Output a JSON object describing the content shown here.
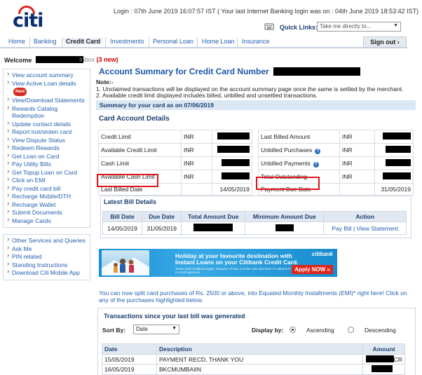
{
  "header": {
    "logo_text": "citi",
    "login_info": "Login : 07th June 2019 16:07:57 IST ( Your last Internet Banking login was on : 04th June 2019 18:53:42 IST)",
    "quick_links_label": "Quick Links:",
    "quick_links_placeholder": "Take me directly to...",
    "sign_out": "Sign out"
  },
  "nav": [
    "Home",
    "Banking",
    "Credit Card",
    "Investments",
    "Personal Loan",
    "Home Loan",
    "Insurance"
  ],
  "welcome": {
    "label": "Welcome",
    "inbox": "Inbox",
    "inbox_new": "(3 new)"
  },
  "sidebar": {
    "group1": [
      "View account summary",
      "View Active Loan details",
      "View/Download Statements",
      "Rewards Catalog Redemption",
      "Update contact details",
      "Report lost/stolen card",
      "View Dispute Status",
      "Redeem Rewards",
      "Get Loan on Card",
      "Pay Utility Bills",
      "Get Topup Loan on Card",
      "Click an EMI",
      "Pay credit card bill",
      "Recharge Mobile/DTH",
      "Recharge Wallet",
      "Submit Documents",
      "Manage Cards"
    ],
    "new_badge": "New",
    "group2": [
      "Other Services and Queries",
      "Ask Me",
      "PIN related",
      "Standing Instructions",
      "Download Citi Mobile App"
    ]
  },
  "main": {
    "title": "Account Summary for Credit Card Number",
    "note_heading": "Note:-",
    "note_1": "1. Unclaimed transactions will be displayed on the account summary page once the same is settled by the merchant.",
    "note_2": "2. Available credit limit displayed includes billed, unbilled and unsettled transactions.",
    "summary_band": "Summary for your card as on 07/06/2019",
    "card_title": "Card Account Details",
    "currency": "INR",
    "left_rows": [
      "Credit Limit",
      "Available Credit Limit",
      "Cash Limit",
      "Available Cash Limit",
      "Last Billed Date"
    ],
    "last_billed_date": "14/05/2019",
    "right_rows": [
      "Last Billed Amount",
      "Unbilled Purchases",
      "Unbilled Payments",
      "Total Outstanding",
      "Payment Due Date"
    ],
    "payment_due_date": "31/05/2019",
    "latest_title": "Latest Bill Details",
    "bill_headers": [
      "Bill Date",
      "Due Date",
      "Total Amount Due",
      "Minimum Amount Due",
      "Action"
    ],
    "bill_row": {
      "bill_date": "14/05/2019",
      "due_date": "31/05/2019",
      "pay": "Pay Bill",
      "sep": "|",
      "view": "View Statement"
    },
    "banner": {
      "line1": "Holiday at your favourite destination with",
      "line2": "Instant Loans on your Citibank Credit Card.",
      "brand": "citibank",
      "apply": "Apply NOW »",
      "small": "Terms and Conditions apply. Issuance of loan is at the sole discretion of Citibank N.A. and is subject to credit approval."
    },
    "emi_text": "You can now split card purchases of Rs. 2500 or above, into Equated Monthly Installments (EMI)* right here! Click on any of the purchases highlighted below.",
    "txn_title": "Transactions since your last bill was generated",
    "sort_by_label": "Sort By:",
    "sort_value": "Date",
    "display_by_label": "Display by:",
    "ascending": "Ascending",
    "descending": "Descending",
    "txn_headers": [
      "Date",
      "Description",
      "Amount"
    ],
    "txn_rows": [
      {
        "date": "15/05/2019",
        "desc": "PAYMENT RECD, THANK YOU",
        "suffix": "CR"
      },
      {
        "date": "16/05/2019",
        "desc": "BKCMUMBAIIN",
        "suffix": ""
      }
    ]
  }
}
